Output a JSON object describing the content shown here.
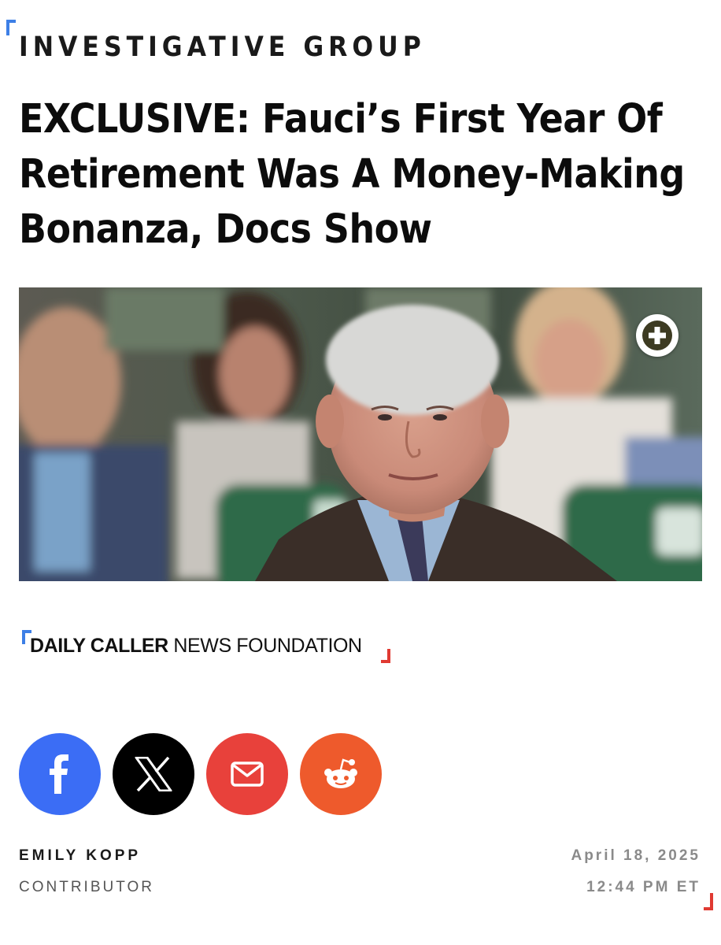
{
  "section": {
    "label": "INVESTIGATIVE GROUP"
  },
  "article": {
    "headline": "EXCLUSIVE: Fauci’s First Year Of Retirement Was A Money-Making Bonanza, Docs Show"
  },
  "hero_image": {
    "expand_icon": "plus-icon"
  },
  "brand": {
    "strong": "DAILY CALLER",
    "light": " NEWS FOUNDATION",
    "accent_blue": "#3d7fe6",
    "accent_red": "#e03a32"
  },
  "share": [
    {
      "name": "facebook",
      "icon": "facebook-icon",
      "color": "#3b6df5"
    },
    {
      "name": "x",
      "icon": "x-icon",
      "color": "#000000"
    },
    {
      "name": "email",
      "icon": "mail-icon",
      "color": "#e8413b"
    },
    {
      "name": "reddit",
      "icon": "reddit-icon",
      "color": "#ee5a2c"
    }
  ],
  "byline": {
    "author": "EMILY KOPP",
    "role": "CONTRIBUTOR",
    "date": "April 18, 2025",
    "time": "12:44 PM ET"
  }
}
